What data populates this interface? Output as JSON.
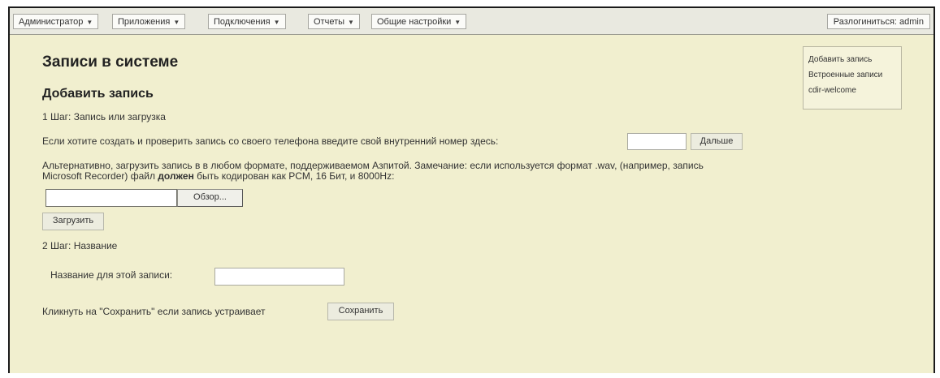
{
  "menu": [
    {
      "label": "Администратор"
    },
    {
      "label": "Приложения"
    },
    {
      "label": "Подключения"
    },
    {
      "label": "Отчеты"
    },
    {
      "label": "Общие настройки"
    }
  ],
  "logout_label": "Разлогиниться: admin",
  "side_links": [
    "Добавить запись",
    "Встроенные записи",
    "cdir-welcome"
  ],
  "page": {
    "title": "Записи в системе",
    "subtitle": "Добавить запись",
    "step1": "1 Шаг: Запись или загрузка",
    "phone_prompt": "Если хотите создать и проверить запись со своего телефона введите свой внутренний номер здесь:",
    "next_button": "Дальше",
    "alt_text_line1": "Альтернативно, загрузить запись в в любом формате, поддерживаемом Азпитой. Замечание: если используется формат .wav, (например, запись",
    "alt_text_line2_a": "Microsoft Recorder) файл ",
    "alt_text_line2_bold": "должен",
    "alt_text_line2_b": " быть кодирован как PCM, 16 Бит, и 8000Hz:",
    "browse_button": "Обзор...",
    "upload_button": "Загрузить",
    "step2": "2 Шаг: Название",
    "name_label": "Название для этой записи:",
    "save_prompt": "Кликнуть на \"Сохранить\" если запись устраивает",
    "save_button": "Сохранить"
  }
}
